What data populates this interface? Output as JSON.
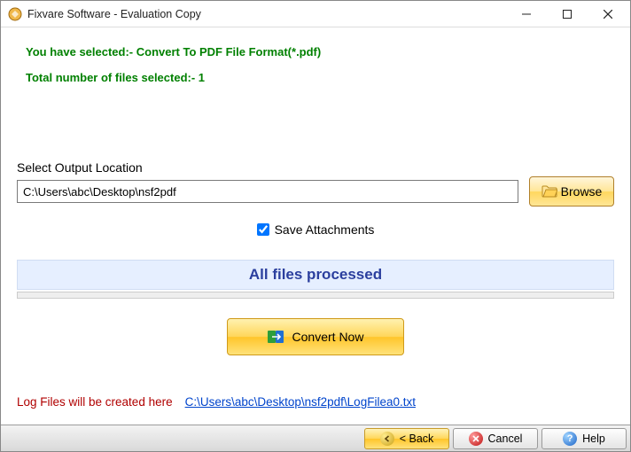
{
  "window": {
    "title": "Fixvare Software - Evaluation Copy"
  },
  "info": {
    "line1": "You have selected:- Convert To PDF File Format(*.pdf)",
    "line2": "Total number of files selected:- 1"
  },
  "output": {
    "label": "Select Output Location",
    "path": "C:\\Users\\abc\\Desktop\\nsf2pdf",
    "browse_label": "Browse"
  },
  "checkbox": {
    "save_attachments_label": "Save Attachments",
    "save_attachments_checked": true
  },
  "status": {
    "text": "All files processed"
  },
  "convert": {
    "label": "Convert Now"
  },
  "log": {
    "label": "Log Files will be created here",
    "path": "C:\\Users\\abc\\Desktop\\nsf2pdf\\LogFilea0.txt"
  },
  "footer": {
    "back": "< Back",
    "cancel": "Cancel",
    "help": "Help"
  }
}
